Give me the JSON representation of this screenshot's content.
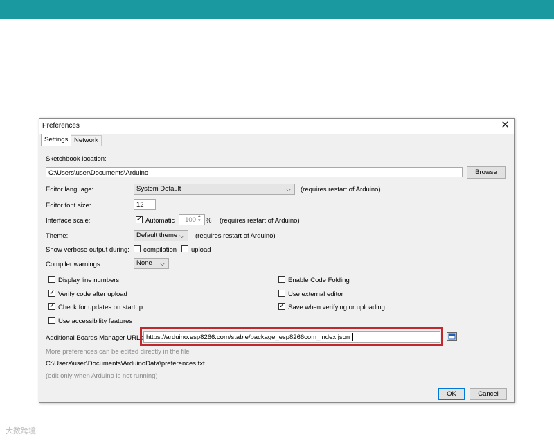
{
  "window": {
    "title": "Preferences",
    "close_glyph": "✕"
  },
  "tabs": [
    {
      "label": "Settings"
    },
    {
      "label": "Network"
    }
  ],
  "sketchbook": {
    "label": "Sketchbook location:",
    "value": "C:\\Users\\user\\Documents\\Arduino",
    "browse_label": "Browse"
  },
  "editor_language": {
    "label": "Editor language:",
    "value": "System Default",
    "note": "(requires restart of Arduino)"
  },
  "font_size": {
    "label": "Editor font size:",
    "value": "12"
  },
  "interface_scale": {
    "label": "Interface scale:",
    "auto_label": "Automatic",
    "auto_checked": true,
    "value": "100",
    "unit": "%",
    "note": "(requires restart of Arduino)"
  },
  "theme": {
    "label": "Theme:",
    "value": "Default theme",
    "note": "(requires restart of Arduino)"
  },
  "verbose": {
    "label": "Show verbose output during:",
    "compilation_label": "compilation",
    "upload_label": "upload"
  },
  "compiler_warnings": {
    "label": "Compiler warnings:",
    "value": "None"
  },
  "options_left": [
    {
      "label": "Display line numbers",
      "checked": false
    },
    {
      "label": "Verify code after upload",
      "checked": true
    },
    {
      "label": "Check for updates on startup",
      "checked": true
    },
    {
      "label": "Use accessibility features",
      "checked": false
    }
  ],
  "options_right": [
    {
      "label": "Enable Code Folding",
      "checked": false
    },
    {
      "label": "Use external editor",
      "checked": false
    },
    {
      "label": "Save when verifying or uploading",
      "checked": true
    }
  ],
  "boards_urls": {
    "label": "Additional Boards Manager URLs:",
    "value": "https://arduino.esp8266.com/stable/package_esp8266com_index.json"
  },
  "more_prefs": "More preferences can be edited directly in the file",
  "prefs_path": "C:\\Users\\user\\Documents\\ArduinoData\\preferences.txt",
  "edit_note": "(edit only when Arduino is not running)",
  "buttons": {
    "ok": "OK",
    "cancel": "Cancel"
  },
  "icons": {
    "check": "✓",
    "chevron": "⌵",
    "spin_up": "▴",
    "spin_down": "▾"
  },
  "watermark": "大数跨境",
  "colors": {
    "topbar": "#1a9aa0",
    "highlight_box": "#c0282d"
  }
}
